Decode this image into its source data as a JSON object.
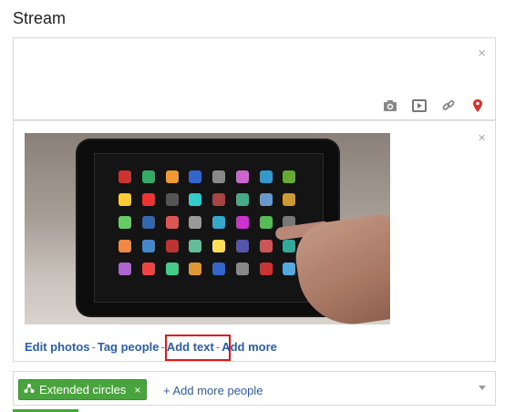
{
  "title": "Stream",
  "compose": {
    "close": "×",
    "tools": [
      "camera-icon",
      "video-icon",
      "link-icon",
      "location-icon"
    ]
  },
  "attachment": {
    "close": "×",
    "links": {
      "edit_photos": "Edit photos",
      "tag_people": "Tag people",
      "add_text": "Add text",
      "add_more": "Add more",
      "sep": "-"
    }
  },
  "share": {
    "chip_label": "Extended circles",
    "chip_remove": "×",
    "add_more_people": "+ Add more people"
  },
  "colors": {
    "link": "#2a5db0",
    "chip": "#4aa43d",
    "highlight": "#e0191b"
  }
}
